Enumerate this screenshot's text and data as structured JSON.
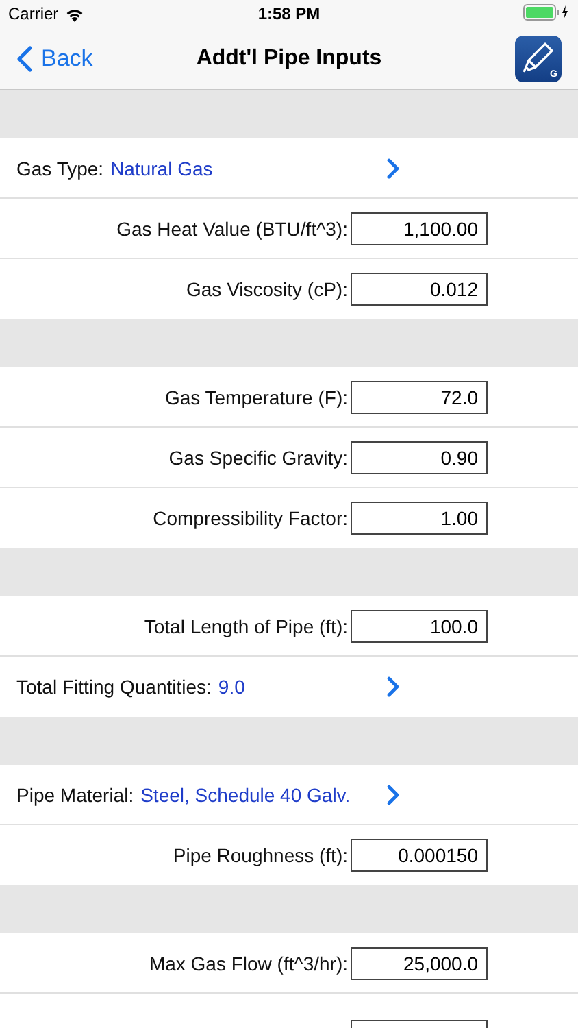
{
  "status_bar": {
    "carrier": "Carrier",
    "time": "1:58 PM"
  },
  "nav": {
    "back": "Back",
    "title": "Addt'l Pipe Inputs",
    "app_icon_letter": "G"
  },
  "groups": [
    {
      "rows": [
        {
          "kind": "link",
          "label": "Gas Type:",
          "value": "Natural Gas"
        },
        {
          "kind": "field",
          "label": "Gas Heat Value (BTU/ft^3):",
          "value": "1,100.00"
        },
        {
          "kind": "field",
          "label": "Gas Viscosity (cP):",
          "value": "0.012"
        }
      ]
    },
    {
      "rows": [
        {
          "kind": "field",
          "label": "Gas Temperature (F):",
          "value": "72.0"
        },
        {
          "kind": "field",
          "label": "Gas Specific Gravity:",
          "value": "0.90"
        },
        {
          "kind": "field",
          "label": "Compressibility Factor:",
          "value": "1.00"
        }
      ]
    },
    {
      "rows": [
        {
          "kind": "field",
          "label": "Total Length of Pipe (ft):",
          "value": "100.0"
        },
        {
          "kind": "link",
          "label": "Total Fitting Quantities:",
          "value": "9.0"
        }
      ]
    },
    {
      "rows": [
        {
          "kind": "link",
          "label": "Pipe Material:",
          "value": "Steel, Schedule 40 Galv."
        },
        {
          "kind": "field",
          "label": "Pipe Roughness (ft):",
          "value": "0.000150"
        }
      ]
    },
    {
      "rows": [
        {
          "kind": "field",
          "label": "Max Gas Flow (ft^3/hr):",
          "value": "25,000.0"
        },
        {
          "kind": "cut_field"
        }
      ]
    }
  ]
}
